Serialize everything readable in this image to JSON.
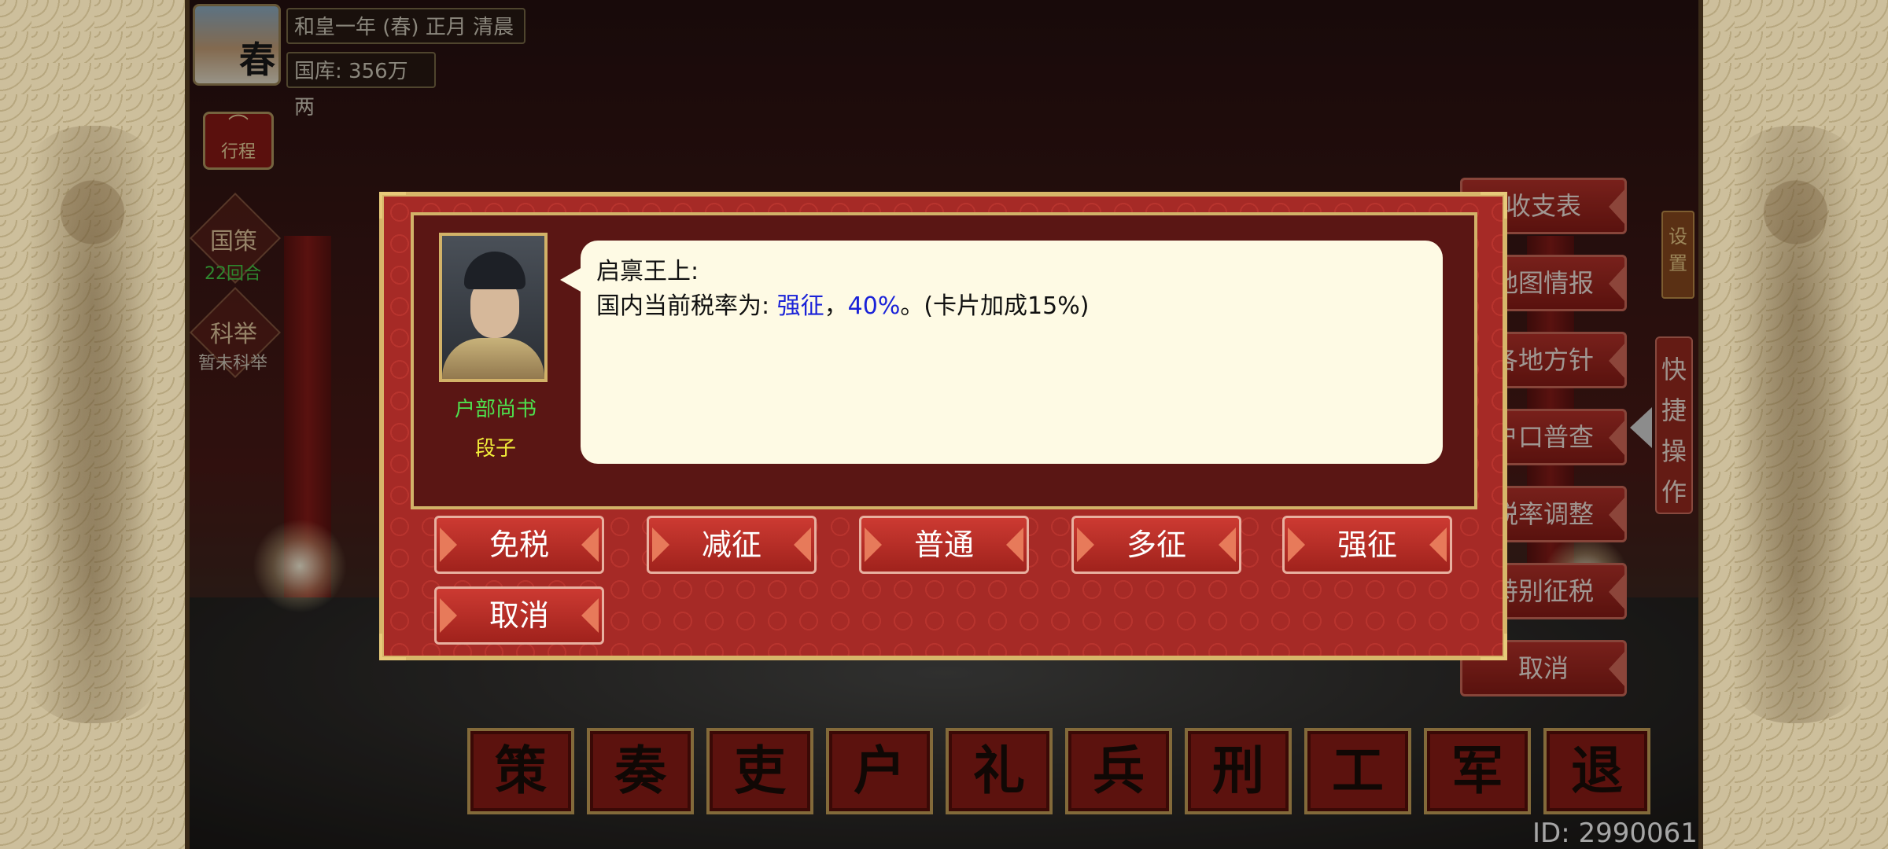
{
  "header": {
    "season_char": "春",
    "date_text": "和皇一年 (春) 正月 清晨",
    "treasury_text": "国库: 356万两"
  },
  "left_sidebar": {
    "itinerary_label": "行程",
    "national_policy": {
      "label": "国策",
      "sub": "22回合"
    },
    "imperial_exam": {
      "label": "科举",
      "sub": "暂未科举"
    }
  },
  "right_menu": {
    "items": [
      "收支表",
      "地图情报",
      "各地方针",
      "户口普查",
      "税率调整",
      "特别征税",
      "取消"
    ],
    "settings_label": "设置",
    "quick_ops_label": "快捷操作"
  },
  "ministries": [
    "策",
    "奏",
    "吏",
    "户",
    "礼",
    "兵",
    "刑",
    "工",
    "军",
    "退"
  ],
  "player_id": "ID: 2990061",
  "dialog": {
    "official_title": "户部尚书",
    "official_name": "段子",
    "message_line1": "启禀王上:",
    "message_prefix": "国内当前税率为: ",
    "rate_name": "强征",
    "separator": "，",
    "rate_value": "40%",
    "message_suffix": "。(卡片加成15%)",
    "buttons": [
      "免税",
      "减征",
      "普通",
      "多征",
      "强征",
      "取消"
    ]
  },
  "colors": {
    "accent_red": "#a0221c",
    "gold_border": "#d7b66a",
    "title_green": "#4ee04e",
    "name_yellow": "#f2ee3a",
    "highlight_blue": "#1a22d8"
  }
}
